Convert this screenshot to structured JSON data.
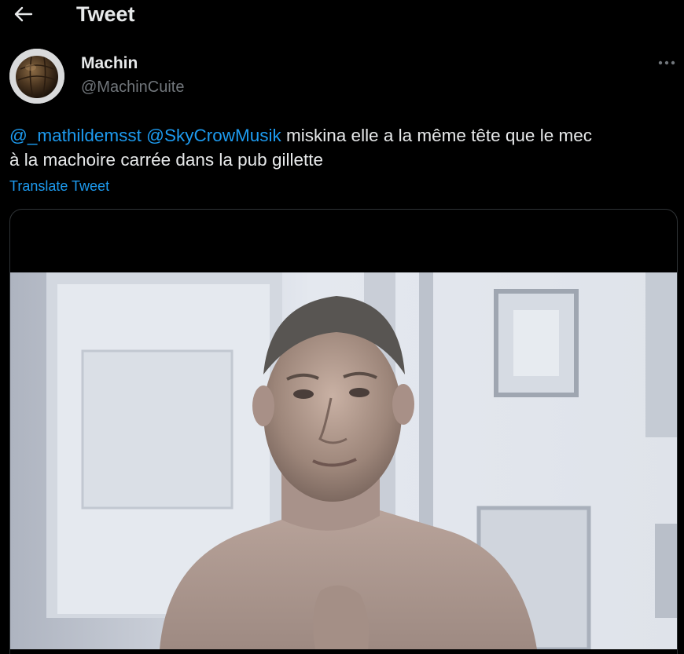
{
  "header": {
    "title": "Tweet",
    "back_icon": "arrow-left-icon"
  },
  "tweet": {
    "author": {
      "display_name": "Machin",
      "handle": "@MachinCuite",
      "avatar_icon": "leather-football-avatar"
    },
    "more_icon": "more-dots-icon",
    "mentions": [
      "@_mathildemsst",
      "@SkyCrowMusik"
    ],
    "text_line1_rest": " miskina elle a la même tête que le mec",
    "text_line2": "à la machoire carrée dans la pub gillette",
    "translate_label": "Translate Tweet",
    "media": {
      "kind": "photo",
      "description_icon": "photo-shirtless-man"
    }
  },
  "colors": {
    "background": "#000000",
    "primary_text": "#e7e9ea",
    "secondary_text": "#71767b",
    "link": "#1d9bf0",
    "border": "#2f3336"
  }
}
